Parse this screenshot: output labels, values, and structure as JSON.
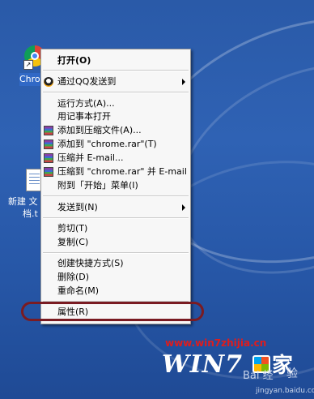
{
  "desktop": {
    "icons": [
      {
        "label": "Chro"
      },
      {
        "label_line1": "新建 文",
        "label_line2": "档.t"
      }
    ]
  },
  "menu": {
    "items": [
      {
        "label": "打开(O)",
        "bold": true
      },
      {
        "label": "通过QQ发送到",
        "icon": "qq-icon",
        "submenu": true
      },
      {
        "label": "运行方式(A)..."
      },
      {
        "label": "用记事本打开"
      },
      {
        "label": "添加到压缩文件(A)...",
        "icon": "winrar-icon"
      },
      {
        "label": "添加到 \"chrome.rar\"(T)",
        "icon": "winrar-icon"
      },
      {
        "label": "压缩并 E-mail...",
        "icon": "winrar-icon"
      },
      {
        "label": "压缩到 \"chrome.rar\" 并 E-mail",
        "icon": "winrar-icon"
      },
      {
        "label": "附到「开始」菜单(I)"
      },
      {
        "label": "发送到(N)",
        "submenu": true
      },
      {
        "label": "剪切(T)"
      },
      {
        "label": "复制(C)"
      },
      {
        "label": "创建快捷方式(S)"
      },
      {
        "label": "删除(D)"
      },
      {
        "label": "重命名(M)"
      },
      {
        "label": "属性(R)",
        "highlighted": true
      }
    ]
  },
  "watermark": {
    "url": "www.win7zhijia.cn",
    "brand": "WIN7",
    "brand_suffix": "家",
    "jingyan_left": "Bai 经",
    "jingyan_right": "验",
    "jingyan_url": "jingyan.baidu.com"
  },
  "colors": {
    "highlight_ring": "#7a1b22",
    "watermark_url": "#e01c1c"
  }
}
